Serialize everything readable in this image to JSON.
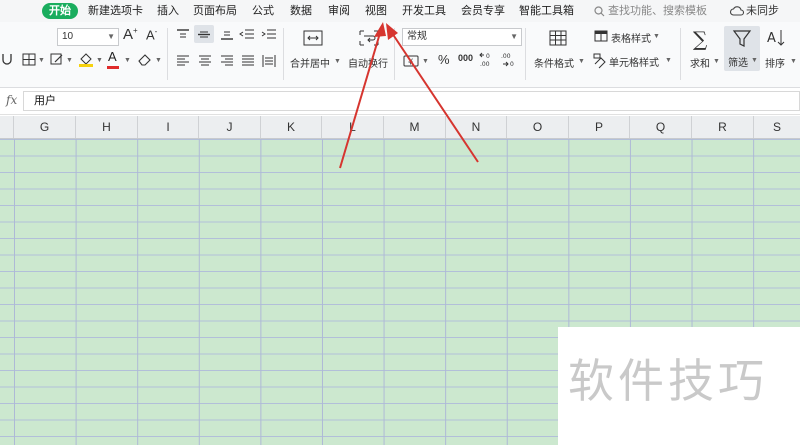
{
  "menu": {
    "tabs": [
      "开始",
      "新建选项卡",
      "插入",
      "页面布局",
      "公式",
      "数据",
      "审阅",
      "视图",
      "开发工具",
      "会员专享",
      "智能工具箱"
    ],
    "search_placeholder": "查找功能、搜索模板",
    "sync_label": "未同步"
  },
  "toolbar": {
    "font_size": "10",
    "grow_font": "A",
    "shrink_font": "A",
    "font_color_glyph": "A",
    "merge_label": "合并居中",
    "wrap_label": "自动换行",
    "number_format": "常规",
    "percent": "%",
    "thousands": "000",
    "cond_format_label": "条件格式",
    "table_style_label": "表格样式",
    "cell_style_label": "单元格样式",
    "sum_label": "求和",
    "filter_label": "筛选",
    "sort_label": "排序"
  },
  "formula_bar": {
    "fx": "fx",
    "value": "用户"
  },
  "columns": [
    "G",
    "H",
    "I",
    "J",
    "K",
    "L",
    "M",
    "N",
    "O",
    "P",
    "Q",
    "R",
    "S"
  ],
  "watermark": "软件技巧",
  "colors": {
    "accent": "#1aad5e",
    "grid_fill": "#cce8cf",
    "arrow": "#d6352f"
  }
}
